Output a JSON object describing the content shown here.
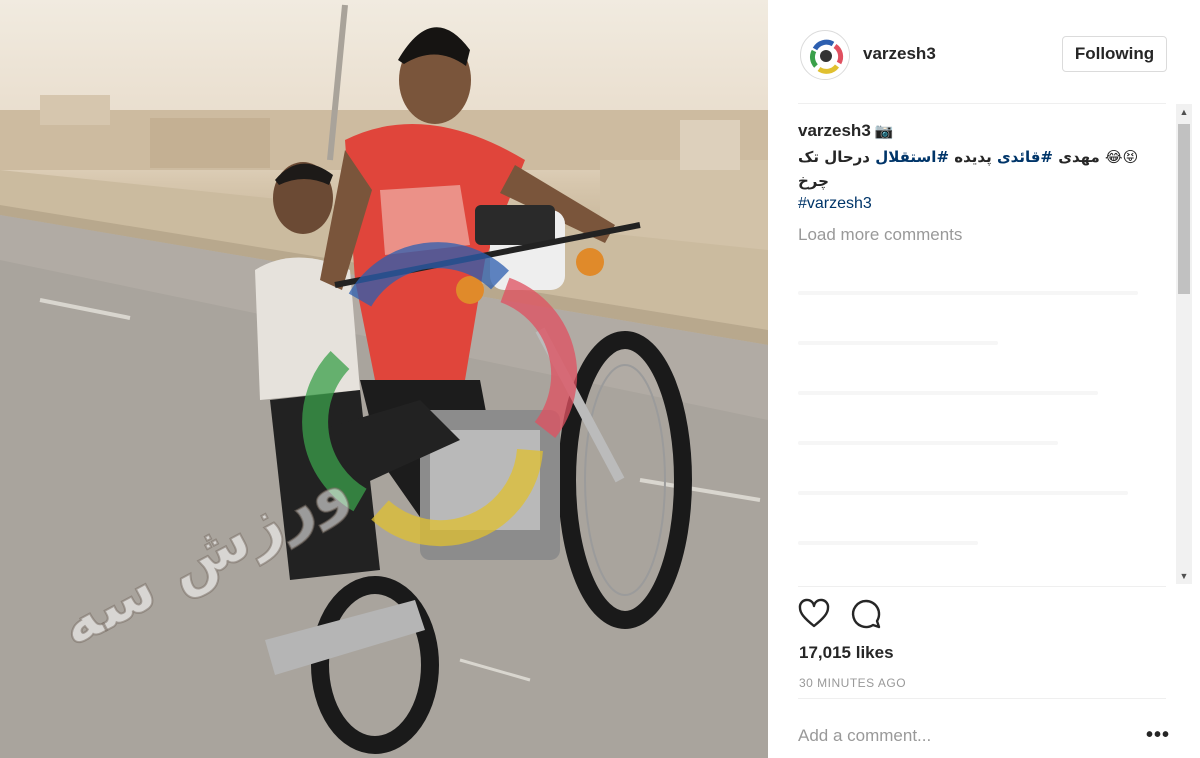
{
  "post": {
    "photo_alt": "Two young men riding a motorcycle on a wheelie along a desert road",
    "watermark_text": "ورزش سه",
    "watermark_logo_text": "۳"
  },
  "header": {
    "username": "varzesh3",
    "follow_label": "Following",
    "avatar_icon": "varzesh3-logo-icon"
  },
  "comments": {
    "author": "varzesh3",
    "author_icon": "camera-emoji",
    "caption_prefix": "😝😂 مهدی ",
    "caption_tag1": "#قائدی",
    "caption_mid": " پدیده ",
    "caption_tag2": "#استقلال",
    "caption_suffix": " درحال تک چرخ",
    "hashtag": "#varzesh3",
    "load_more_label": "Load more comments"
  },
  "actions": {
    "like_icon": "heart-icon",
    "comment_icon": "comment-bubble-icon",
    "likes_text": "17,015 likes",
    "time_text": "30 MINUTES AGO"
  },
  "comment_bar": {
    "placeholder": "Add a comment...",
    "more_label": "•••"
  },
  "scrollbar": {
    "up": "▲",
    "down": "▼"
  }
}
